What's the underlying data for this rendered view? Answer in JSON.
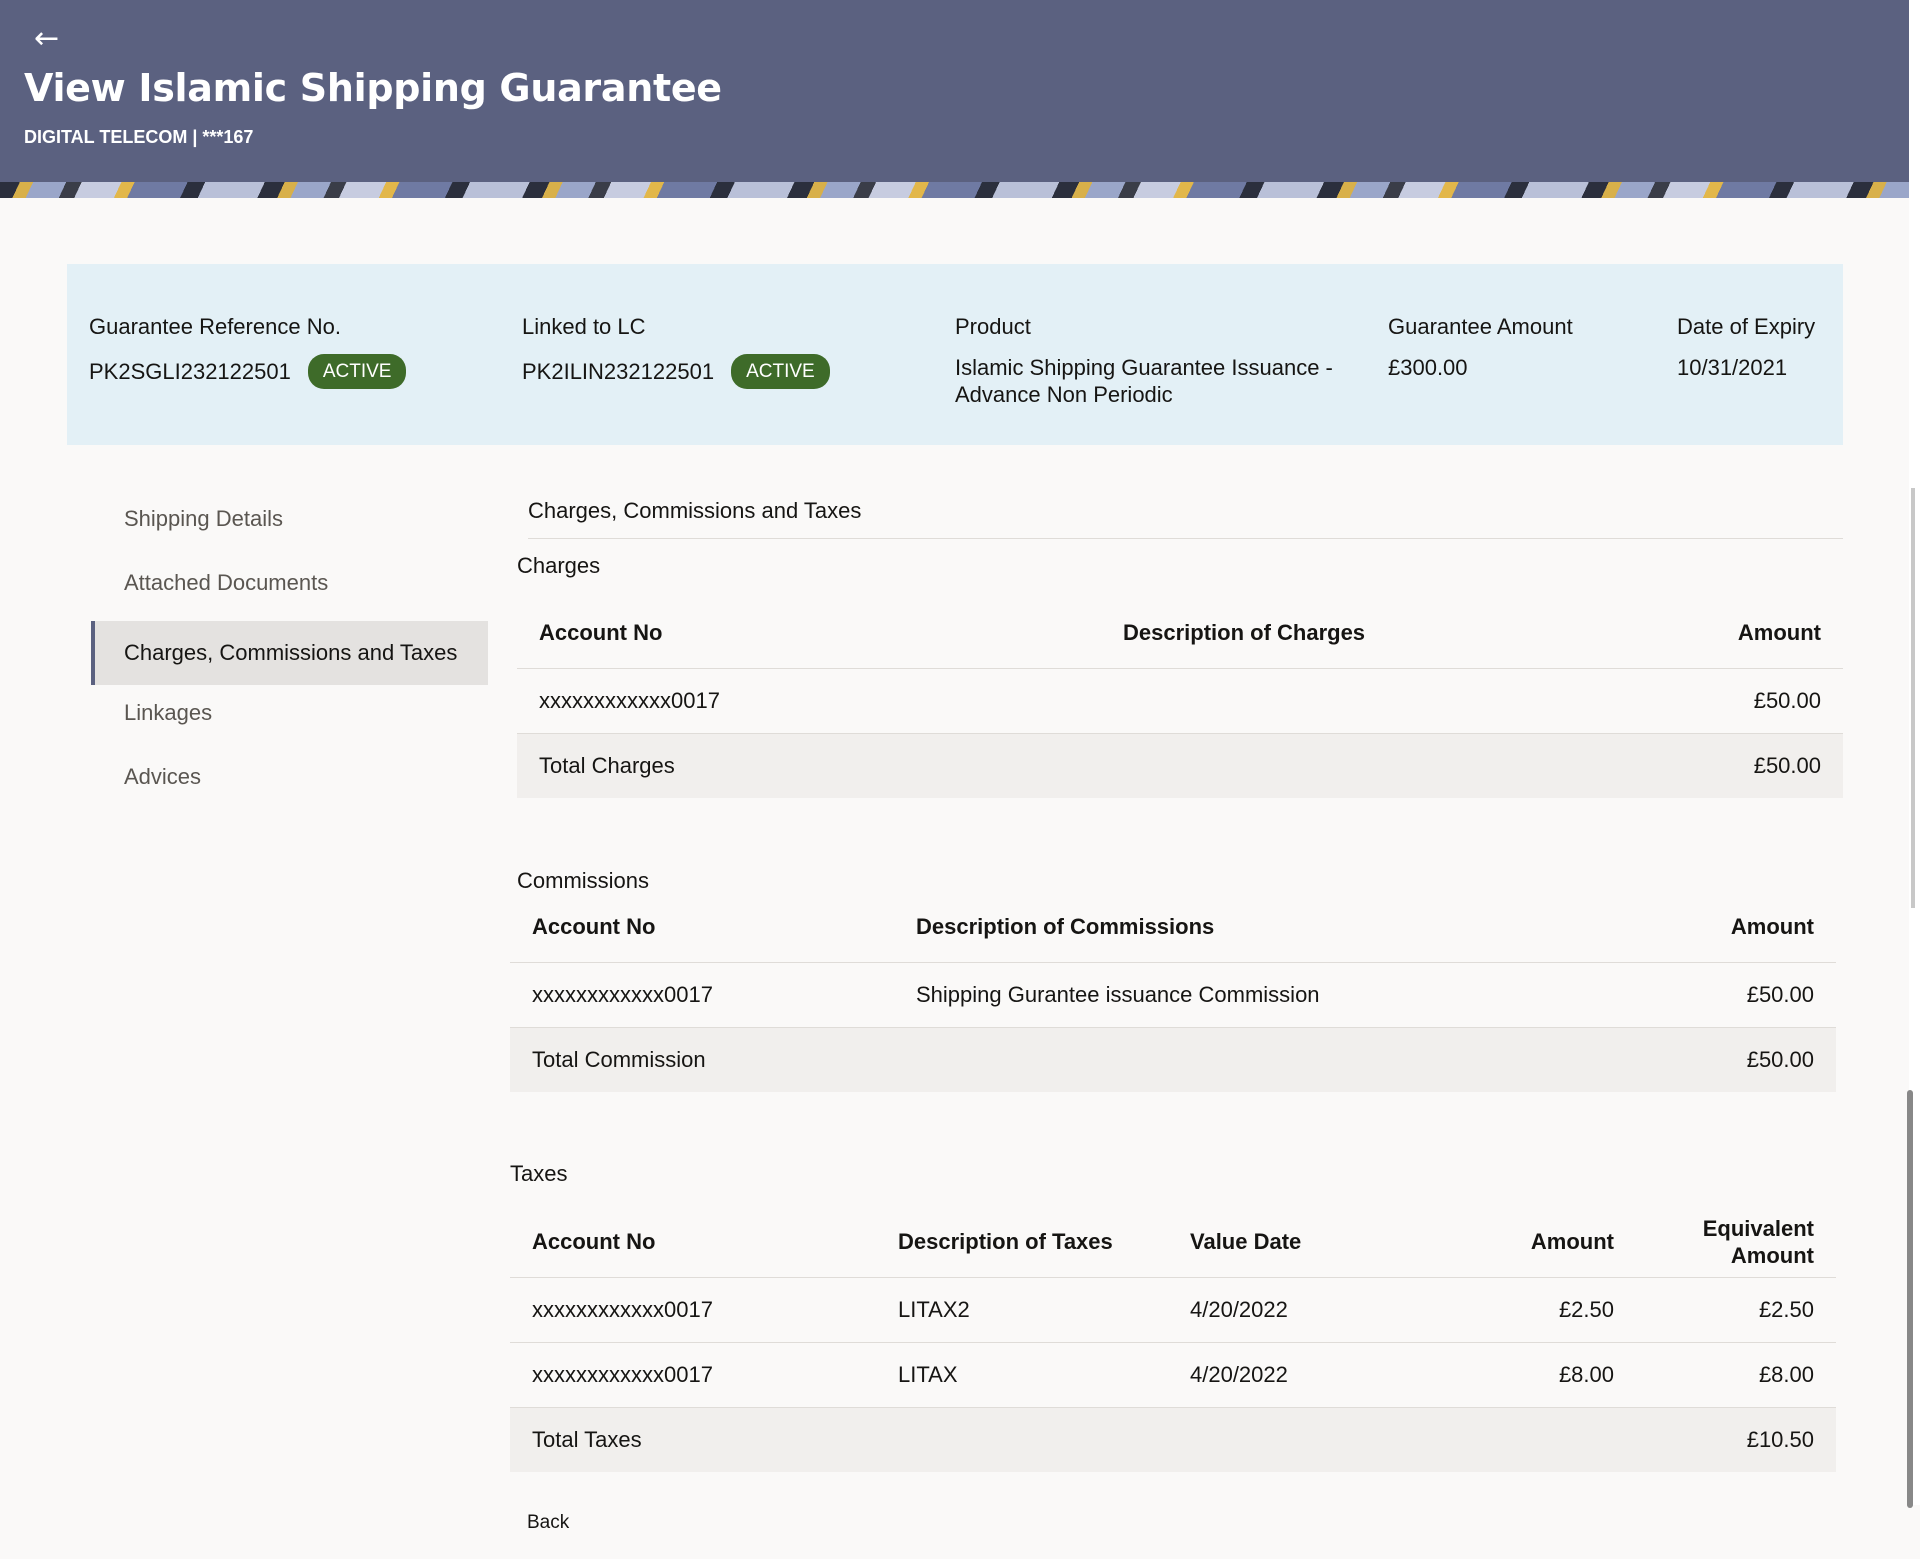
{
  "header": {
    "back_icon": "arrow-left-icon",
    "title": "View Islamic Shipping Guarantee",
    "subtitle": "DIGITAL TELECOM | ***167"
  },
  "summary": {
    "reference": {
      "label": "Guarantee Reference No.",
      "value": "PK2SGLI232122501",
      "status": "ACTIVE"
    },
    "linked_lc": {
      "label": "Linked to LC",
      "value": "PK2ILIN232122501",
      "status": "ACTIVE"
    },
    "product": {
      "label": "Product",
      "line1": "Islamic Shipping Guarantee Issuance -",
      "line2": "Advance Non Periodic"
    },
    "amount": {
      "label": "Guarantee Amount",
      "value": "£300.00"
    },
    "expiry": {
      "label": "Date of Expiry",
      "value": "10/31/2021"
    }
  },
  "sidebar": {
    "items": [
      {
        "label": "Shipping Details"
      },
      {
        "label": "Attached Documents"
      },
      {
        "label": "Charges, Commissions and Taxes"
      },
      {
        "label": "Linkages"
      },
      {
        "label": "Advices"
      }
    ]
  },
  "section_title": "Charges, Commissions and Taxes",
  "charges": {
    "title": "Charges",
    "headers": [
      "Account No",
      "Description of Charges",
      "Amount"
    ],
    "rows": [
      {
        "account": "xxxxxxxxxxxx0017",
        "description": "",
        "amount": "£50.00"
      }
    ],
    "total_label": "Total Charges",
    "total_amount": "£50.00"
  },
  "commissions": {
    "title": "Commissions",
    "headers": [
      "Account No",
      "Description of Commissions",
      "Amount"
    ],
    "rows": [
      {
        "account": "xxxxxxxxxxxx0017",
        "description": "Shipping Gurantee issuance Commission",
        "amount": "£50.00"
      }
    ],
    "total_label": "Total Commission",
    "total_amount": "£50.00"
  },
  "taxes": {
    "title": "Taxes",
    "headers": [
      "Account No",
      "Description of Taxes",
      "Value Date",
      "Amount",
      "Equivalent Amount"
    ],
    "equiv_line1": "Equivalent",
    "equiv_line2": "Amount",
    "rows": [
      {
        "account": "xxxxxxxxxxxx0017",
        "description": "LITAX2",
        "date": "4/20/2022",
        "amount": "£2.50",
        "equivalent": "£2.50"
      },
      {
        "account": "xxxxxxxxxxxx0017",
        "description": "LITAX",
        "date": "4/20/2022",
        "amount": "£8.00",
        "equivalent": "£8.00"
      }
    ],
    "total_label": "Total Taxes",
    "total_amount": "£10.50"
  },
  "footer": {
    "back_label": "Back"
  }
}
